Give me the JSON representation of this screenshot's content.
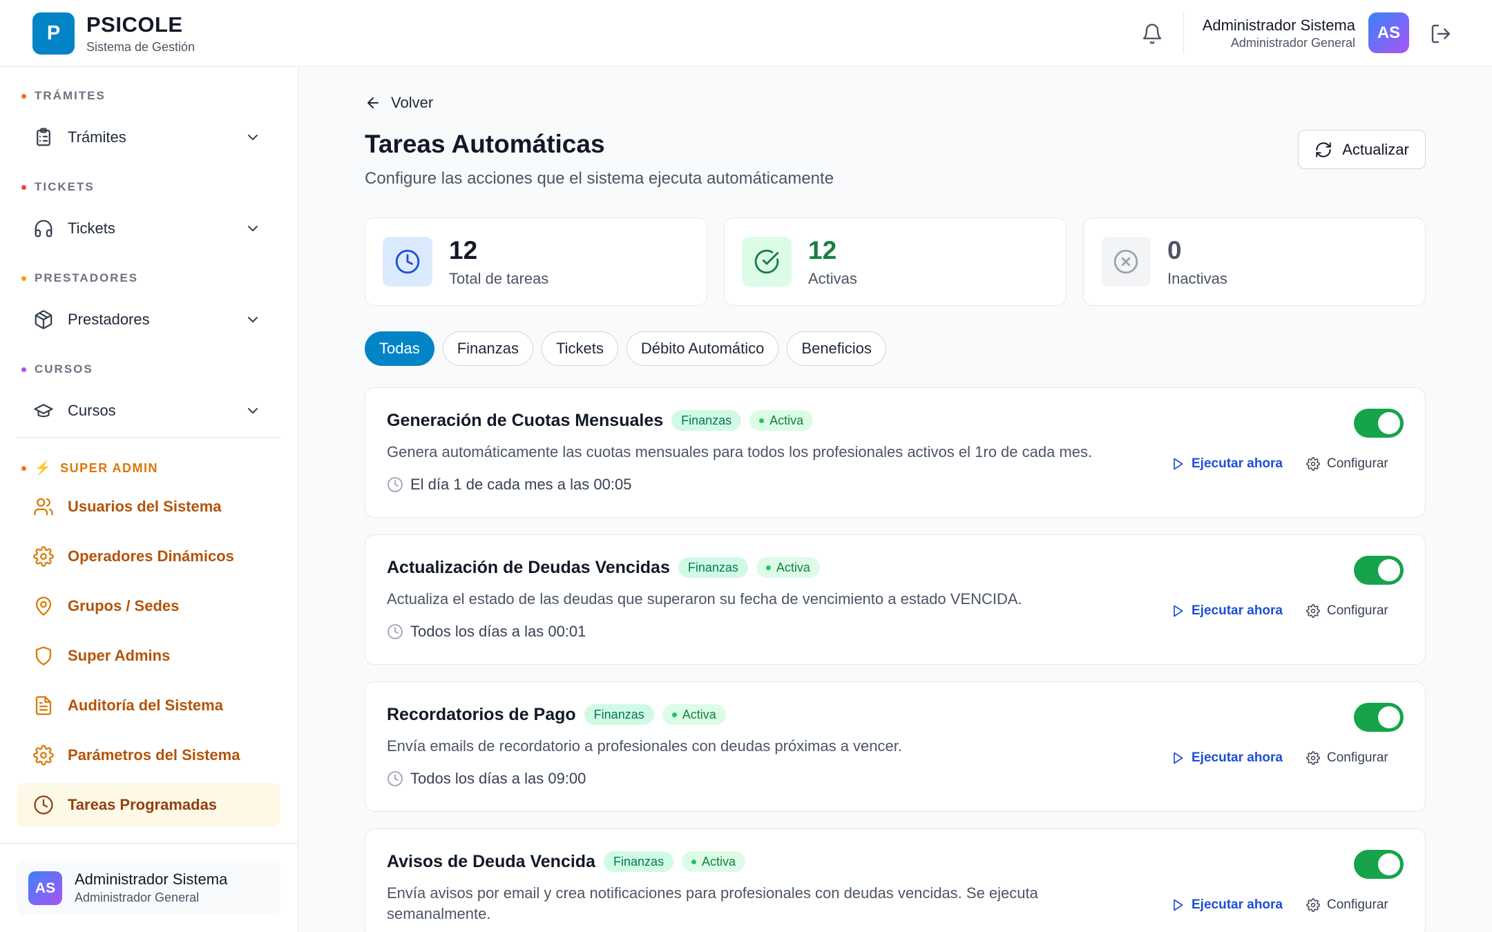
{
  "header": {
    "logo_letter": "P",
    "brand_name": "PSICOLE",
    "brand_subtitle": "Sistema de Gestión",
    "user_name": "Administrador Sistema",
    "user_role": "Administrador General",
    "avatar_initials": "AS",
    "icons": [
      "bell-icon",
      "logout-icon"
    ]
  },
  "sidebar": {
    "sections": [
      {
        "label": "TRÁMITES",
        "dot_color": "#f97316",
        "item": {
          "label": "Trámites",
          "icon": "clipboard-icon"
        }
      },
      {
        "label": "TICKETS",
        "dot_color": "#ef4444",
        "item": {
          "label": "Tickets",
          "icon": "headphones-icon"
        }
      },
      {
        "label": "PRESTADORES",
        "dot_color": "#f59e0b",
        "item": {
          "label": "Prestadores",
          "icon": "box-icon"
        }
      },
      {
        "label": "CURSOS",
        "dot_color": "#a855f7",
        "item": {
          "label": "Cursos",
          "icon": "graduation-cap-icon"
        }
      }
    ],
    "super_admin": {
      "label": "SUPER ADMIN",
      "icon": "lightning-icon",
      "accent_color": "#d97706",
      "items": [
        {
          "label": "Usuarios del Sistema",
          "icon": "users-icon"
        },
        {
          "label": "Operadores Dinámicos",
          "icon": "gear-icon"
        },
        {
          "label": "Grupos / Sedes",
          "icon": "map-pin-icon"
        },
        {
          "label": "Super Admins",
          "icon": "shield-icon"
        },
        {
          "label": "Auditoría del Sistema",
          "icon": "document-icon"
        },
        {
          "label": "Parámetros del Sistema",
          "icon": "gear-icon"
        },
        {
          "label": "Tareas Programadas",
          "icon": "clock-icon",
          "active": true
        }
      ]
    },
    "user": {
      "initials": "AS",
      "name": "Administrador Sistema",
      "role": "Administrador General"
    }
  },
  "main": {
    "back_label": "Volver",
    "title": "Tareas Automáticas",
    "subtitle": "Configure las acciones que el sistema ejecuta automáticamente",
    "refresh_label": "Actualizar",
    "stats": [
      {
        "value": "12",
        "label": "Total de tareas",
        "icon": "clock-icon",
        "color": "#1d4ed8"
      },
      {
        "value": "12",
        "label": "Activas",
        "icon": "check-circle-icon",
        "color": "#15803d"
      },
      {
        "value": "0",
        "label": "Inactivas",
        "icon": "x-circle-icon",
        "color": "#4b5563"
      }
    ],
    "filters": [
      "Todas",
      "Finanzas",
      "Tickets",
      "Débito Automático",
      "Beneficios"
    ],
    "active_filter": "Todas",
    "tasks": [
      {
        "name": "Generación de Cuotas Mensuales",
        "category": "Finanzas",
        "status": "Activa",
        "description": "Genera automáticamente las cuotas mensuales para todos los profesionales activos el 1ro de cada mes.",
        "schedule": "El día 1 de cada mes a las 00:05",
        "enabled": true
      },
      {
        "name": "Actualización de Deudas Vencidas",
        "category": "Finanzas",
        "status": "Activa",
        "description": "Actualiza el estado de las deudas que superaron su fecha de vencimiento a estado VENCIDA.",
        "schedule": "Todos los días a las 00:01",
        "enabled": true
      },
      {
        "name": "Recordatorios de Pago",
        "category": "Finanzas",
        "status": "Activa",
        "description": "Envía emails de recordatorio a profesionales con deudas próximas a vencer.",
        "schedule": "Todos los días a las 09:00",
        "enabled": true
      },
      {
        "name": "Avisos de Deuda Vencida",
        "category": "Finanzas",
        "status": "Activa",
        "description": "Envía avisos por email y crea notificaciones para profesionales con deudas vencidas. Se ejecuta semanalmente.",
        "schedule": "",
        "enabled": true
      }
    ],
    "run_label": "Ejecutar ahora",
    "config_label": "Configurar"
  }
}
